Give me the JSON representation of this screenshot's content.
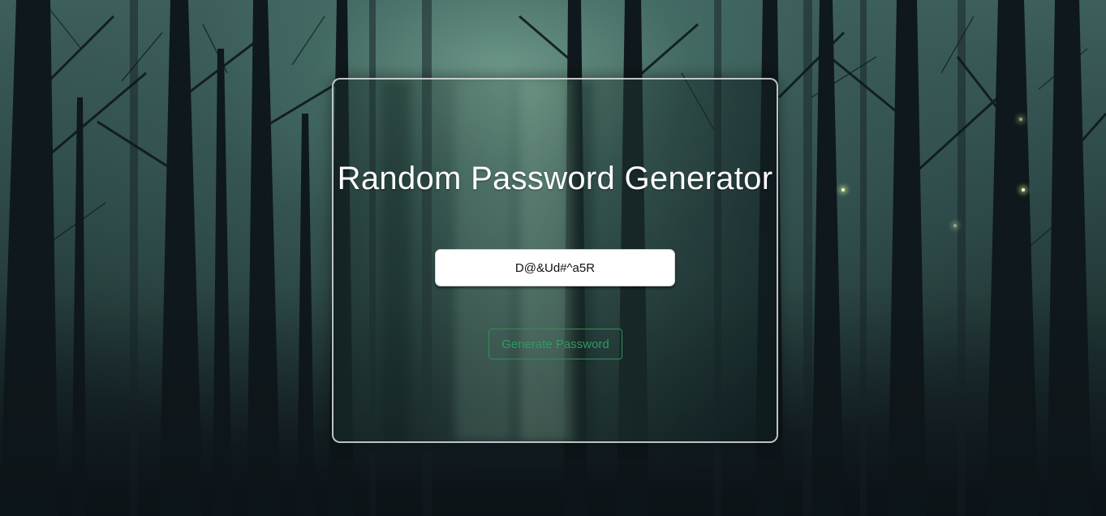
{
  "app": {
    "title": "Random Password Generator"
  },
  "password_field": {
    "value": "D@&Ud#^a5R",
    "placeholder": ""
  },
  "actions": {
    "generate_label": "Generate Password"
  },
  "colors": {
    "card_border": "#dcdfe0",
    "title_text": "#ffffff",
    "button_border": "#2c8f58",
    "button_text": "#2f9a5f",
    "input_background": "#ffffff"
  }
}
